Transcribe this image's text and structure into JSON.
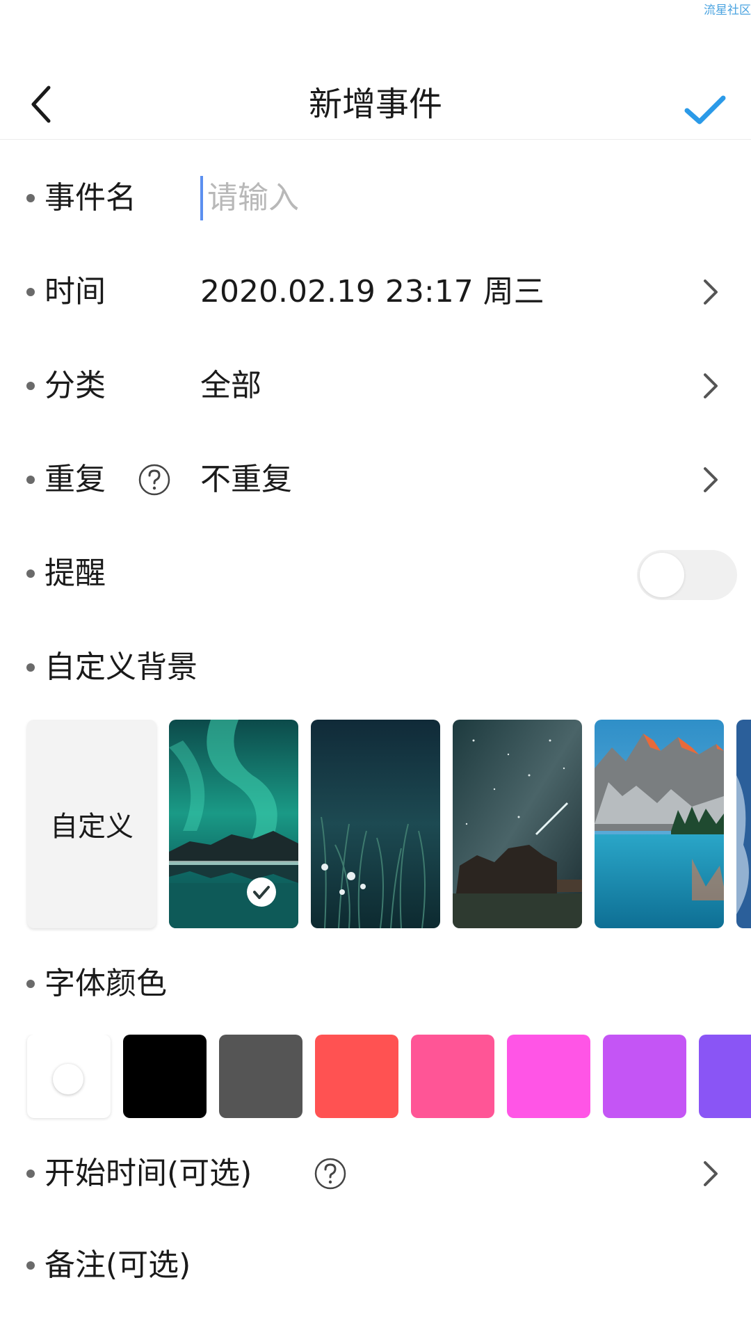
{
  "watermark": "流星社区",
  "header": {
    "title": "新增事件",
    "accent_color": "#2b9ae8"
  },
  "form": {
    "name": {
      "label": "事件名",
      "placeholder": "请输入",
      "value": ""
    },
    "time": {
      "label": "时间",
      "value": "2020.02.19 23:17 周三"
    },
    "category": {
      "label": "分类",
      "value": "全部"
    },
    "repeat": {
      "label": "重复",
      "value": "不重复"
    },
    "reminder": {
      "label": "提醒",
      "enabled": false
    },
    "background": {
      "label": "自定义背景",
      "custom_label": "自定义",
      "options": [
        "aurora",
        "night-flowers",
        "milky-way-cabin",
        "mountain-lake",
        "blue-partial"
      ],
      "selected": "aurora"
    },
    "font_color": {
      "label": "字体颜色",
      "swatches": [
        "#ffffff",
        "#000000",
        "#555555",
        "#ff5252",
        "#ff5596",
        "#ff55e6",
        "#c455f5",
        "#8a55f5"
      ],
      "selected": "#ffffff"
    },
    "start_time": {
      "label": "开始时间(可选)"
    },
    "note": {
      "label": "备注(可选)"
    }
  }
}
